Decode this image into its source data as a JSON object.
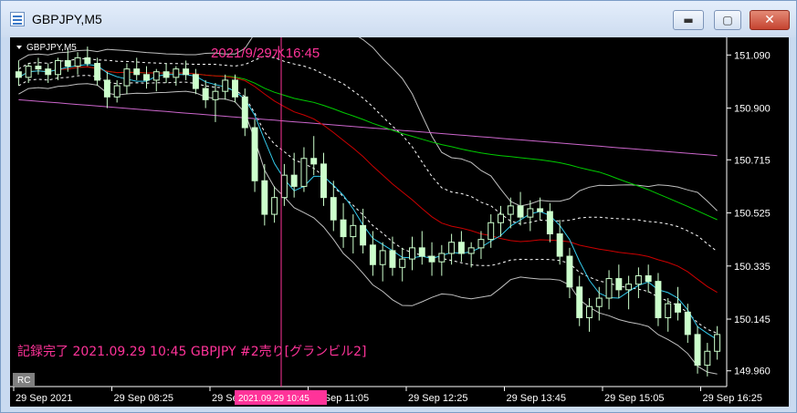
{
  "window": {
    "title": "GBPJPY,M5",
    "min_symbol": "▬",
    "max_symbol": "▢",
    "close_symbol": "✕"
  },
  "chart": {
    "symbol_label": "GBPJPY,M5",
    "crosshair_label": "2021/9/29水16:45",
    "crosshair_time_badge": "2021.09.29 10:45",
    "record_note": "記録完了  2021.09.29 10:45 GBPJPY  #2売り[グランビル2]",
    "rc_label": "RC"
  },
  "chart_data": {
    "type": "candlestick",
    "price_ticks": [
      "151.090",
      "150.900",
      "150.715",
      "150.525",
      "150.335",
      "150.145",
      "149.960"
    ],
    "time_ticks": [
      "29 Sep 2021",
      "29 Sep 08:25",
      "29 Sep",
      "29 Sep 11:05",
      "29 Sep 12:25",
      "29 Sep 13:45",
      "29 Sep 15:05",
      "29 Sep 16:25"
    ],
    "ylim": [
      149.92,
      151.14
    ],
    "grid": false,
    "colors": {
      "background": "#000000",
      "bull": "#ccffcc",
      "bear": "#ccffcc",
      "ma_long": "#cc66cc",
      "ma_mid": "#00cc00",
      "ma_short": "#cc0000",
      "ma_fast": "#33ccee",
      "bands": "#c0c0c0",
      "crosshair": "#ff3399",
      "note": "#ff3399"
    },
    "candles": [
      [
        151.03,
        151.07,
        150.98,
        151.01
      ],
      [
        151.01,
        151.06,
        150.99,
        151.05
      ],
      [
        151.05,
        151.08,
        151.02,
        151.04
      ],
      [
        151.04,
        151.06,
        150.99,
        151.02
      ],
      [
        151.02,
        151.08,
        151.0,
        151.07
      ],
      [
        151.07,
        151.11,
        151.03,
        151.05
      ],
      [
        151.05,
        151.1,
        151.02,
        151.08
      ],
      [
        151.08,
        151.12,
        151.05,
        151.06
      ],
      [
        151.06,
        151.08,
        150.98,
        151.0
      ],
      [
        151.0,
        151.03,
        150.9,
        150.94
      ],
      [
        150.94,
        151.0,
        150.92,
        150.98
      ],
      [
        150.98,
        151.06,
        150.95,
        151.04
      ],
      [
        151.04,
        151.08,
        151.0,
        151.02
      ],
      [
        151.02,
        151.05,
        150.97,
        151.0
      ],
      [
        151.0,
        151.04,
        150.96,
        151.03
      ],
      [
        151.03,
        151.06,
        150.99,
        151.01
      ],
      [
        151.01,
        151.05,
        150.98,
        151.04
      ],
      [
        151.04,
        151.07,
        151.0,
        151.02
      ],
      [
        151.02,
        151.04,
        150.95,
        150.97
      ],
      [
        150.97,
        151.0,
        150.9,
        150.93
      ],
      [
        150.93,
        150.99,
        150.85,
        150.96
      ],
      [
        150.96,
        151.02,
        150.93,
        151.0
      ],
      [
        151.0,
        151.02,
        150.92,
        150.94
      ],
      [
        150.94,
        150.97,
        150.8,
        150.83
      ],
      [
        150.83,
        150.86,
        150.6,
        150.64
      ],
      [
        150.64,
        150.7,
        150.48,
        150.52
      ],
      [
        150.52,
        150.62,
        150.49,
        150.58
      ],
      [
        150.58,
        150.7,
        150.55,
        150.66
      ],
      [
        150.66,
        150.74,
        150.58,
        150.62
      ],
      [
        150.62,
        150.76,
        150.6,
        150.72
      ],
      [
        150.72,
        150.8,
        150.66,
        150.7
      ],
      [
        150.7,
        150.74,
        150.55,
        150.58
      ],
      [
        150.58,
        150.64,
        150.46,
        150.5
      ],
      [
        150.5,
        150.56,
        150.4,
        150.44
      ],
      [
        150.44,
        150.52,
        150.38,
        150.48
      ],
      [
        150.48,
        150.54,
        150.38,
        150.41
      ],
      [
        150.41,
        150.46,
        150.3,
        150.34
      ],
      [
        150.34,
        150.42,
        150.28,
        150.39
      ],
      [
        150.39,
        150.44,
        150.3,
        150.33
      ],
      [
        150.33,
        150.4,
        150.28,
        150.36
      ],
      [
        150.36,
        150.44,
        150.32,
        150.4
      ],
      [
        150.4,
        150.46,
        150.34,
        150.37
      ],
      [
        150.37,
        150.42,
        150.3,
        150.35
      ],
      [
        150.35,
        150.41,
        150.3,
        150.38
      ],
      [
        150.38,
        150.45,
        150.34,
        150.42
      ],
      [
        150.42,
        150.46,
        150.35,
        150.38
      ],
      [
        150.38,
        150.42,
        150.33,
        150.4
      ],
      [
        150.4,
        150.46,
        150.36,
        150.43
      ],
      [
        150.43,
        150.52,
        150.4,
        150.49
      ],
      [
        150.49,
        150.55,
        150.44,
        150.52
      ],
      [
        150.52,
        150.58,
        150.47,
        150.55
      ],
      [
        150.55,
        150.6,
        150.48,
        150.51
      ],
      [
        150.51,
        150.57,
        150.46,
        150.54
      ],
      [
        150.54,
        150.58,
        150.5,
        150.53
      ],
      [
        150.53,
        150.56,
        150.42,
        150.45
      ],
      [
        150.45,
        150.5,
        150.34,
        150.37
      ],
      [
        150.37,
        150.4,
        150.22,
        150.26
      ],
      [
        150.26,
        150.3,
        150.12,
        150.15
      ],
      [
        150.15,
        150.22,
        150.1,
        150.19
      ],
      [
        150.19,
        150.26,
        150.14,
        150.22
      ],
      [
        150.22,
        150.32,
        150.18,
        150.29
      ],
      [
        150.29,
        150.34,
        150.22,
        150.25
      ],
      [
        150.25,
        150.3,
        150.18,
        150.27
      ],
      [
        150.27,
        150.33,
        150.22,
        150.3
      ],
      [
        150.3,
        150.34,
        150.24,
        150.28
      ],
      [
        150.28,
        150.31,
        150.12,
        150.15
      ],
      [
        150.15,
        150.22,
        150.1,
        150.2
      ],
      [
        150.2,
        150.26,
        150.14,
        150.17
      ],
      [
        150.17,
        150.2,
        150.06,
        150.09
      ],
      [
        150.09,
        150.12,
        149.95,
        149.98
      ],
      [
        149.98,
        150.06,
        149.94,
        150.03
      ],
      [
        150.03,
        150.12,
        150.0,
        150.09
      ]
    ]
  }
}
